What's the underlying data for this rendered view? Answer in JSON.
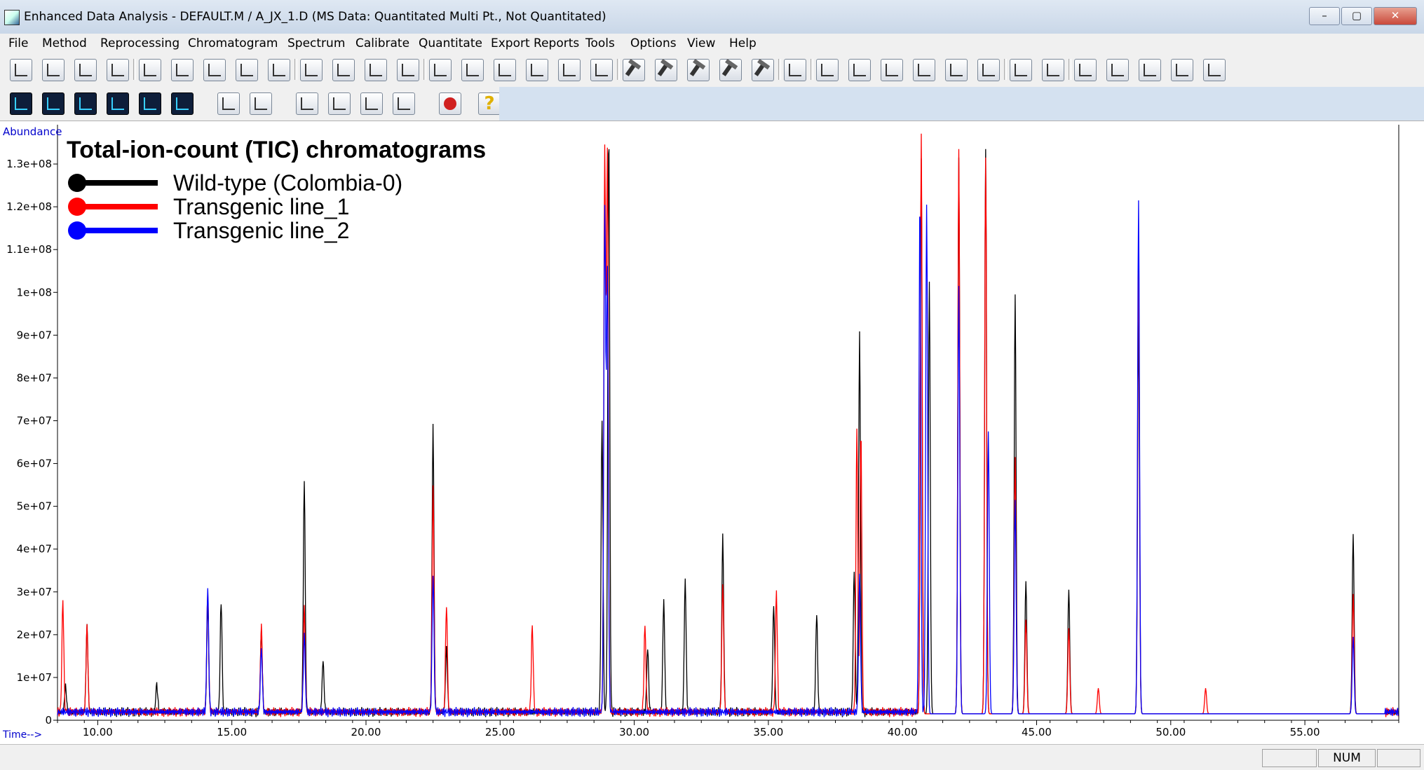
{
  "window": {
    "title": "Enhanced Data Analysis - DEFAULT.M / A_JX_1.D    (MS Data: Quantitated Multi Pt., Not Quantitated)",
    "controls": {
      "minimize": "–",
      "maximize": "▢",
      "close": "✕"
    }
  },
  "menu": [
    "File",
    "Method",
    "Reprocessing",
    "Chromatogram",
    "Spectrum",
    "Calibrate",
    "Quantitate",
    "Export Reports",
    "Tools",
    "Options",
    "View",
    "Help"
  ],
  "toolbar1_icons": [
    "load-data-icon",
    "load-method-icon",
    "print-setup-icon",
    "print-icon",
    "open-file-icon",
    "save-file-icon",
    "run-method-icon",
    "sim-icon",
    "sim-edit-icon",
    "copy-icon",
    "screen-icon",
    "color-grid-icon",
    "windows-icon",
    "report-icon",
    "edit-ions-icon",
    "edit-note-icon",
    "integrate-icon",
    "library-icon",
    "signal-icon",
    "hammer-1-icon",
    "hammer-2-icon",
    "hammer-3-icon",
    "hammer-4-icon",
    "hammer-5-icon",
    "compass-icon",
    "peak-icon",
    "peak-split-icon",
    "calc-icon",
    "bar-icon",
    "building-icon",
    "house-icon",
    "axis-icon",
    "check-axis-icon",
    "chart-up-icon",
    "arrow-up-icon",
    "table-icon",
    "copy-table-icon",
    "edit-table-icon"
  ],
  "toolbar2_icons": [
    "tic-icon",
    "extract-icon",
    "mz-icon",
    "chrom-plus-icon",
    "spectrum-icon",
    "overlay-icon",
    "document-icon",
    "export-icon",
    "checklist-icon",
    "hand-icon",
    "tag-icon",
    "integrator-icon",
    "stop-icon",
    "help-icon"
  ],
  "chart_data": {
    "type": "line",
    "title": "Total-ion-count (TIC) chromatograms",
    "ylabel": "Abundance",
    "xlabel": "Time-->",
    "xlim": [
      8.5,
      58.5
    ],
    "ylim": [
      0,
      140000000
    ],
    "xticks": [
      10,
      15,
      20,
      25,
      30,
      35,
      40,
      45,
      50,
      55
    ],
    "xtick_labels": [
      "10.00",
      "15.00",
      "20.00",
      "25.00",
      "30.00",
      "35.00",
      "40.00",
      "45.00",
      "50.00",
      "55.00"
    ],
    "yticks": [
      0,
      10000000,
      20000000,
      30000000,
      40000000,
      50000000,
      60000000,
      70000000,
      80000000,
      90000000,
      100000000,
      110000000,
      120000000,
      130000000
    ],
    "ytick_labels": [
      "0",
      "1e+07",
      "2e+07",
      "3e+07",
      "4e+07",
      "5e+07",
      "6e+07",
      "7e+07",
      "8e+07",
      "9e+07",
      "1e+08",
      "1.1e+08",
      "1.2e+08",
      "1.3e+08"
    ],
    "legend_position": "top-left",
    "series": [
      {
        "name": "Wild-type (Colombia-0)",
        "color": "#000000",
        "baseline": 1500000,
        "peaks": [
          [
            8.8,
            6000000
          ],
          [
            9.6,
            20000000
          ],
          [
            12.2,
            6500000
          ],
          [
            14.1,
            25000000
          ],
          [
            14.6,
            26000000
          ],
          [
            16.1,
            19000000
          ],
          [
            17.7,
            54000000
          ],
          [
            18.4,
            12000000
          ],
          [
            22.5,
            67000000
          ],
          [
            23.0,
            15000000
          ],
          [
            28.8,
            68000000
          ],
          [
            29.05,
            137000000
          ],
          [
            30.5,
            15000000
          ],
          [
            31.1,
            26000000
          ],
          [
            31.9,
            31000000
          ],
          [
            33.3,
            41000000
          ],
          [
            35.2,
            25000000
          ],
          [
            36.8,
            23000000
          ],
          [
            38.2,
            33000000
          ],
          [
            38.4,
            88000000
          ],
          [
            40.7,
            130000000
          ],
          [
            41.0,
            101000000
          ],
          [
            42.1,
            130000000
          ],
          [
            43.1,
            132000000
          ],
          [
            44.2,
            98000000
          ],
          [
            44.6,
            31000000
          ],
          [
            46.2,
            29000000
          ],
          [
            48.8,
            92000000
          ],
          [
            56.8,
            42000000
          ]
        ]
      },
      {
        "name": "Transgenic line_1",
        "color": "#ff0000",
        "baseline": 1500000,
        "peaks": [
          [
            8.7,
            26000000
          ],
          [
            9.6,
            20000000
          ],
          [
            14.1,
            28000000
          ],
          [
            16.1,
            20000000
          ],
          [
            17.7,
            24000000
          ],
          [
            22.5,
            52000000
          ],
          [
            23.0,
            25000000
          ],
          [
            26.2,
            20000000
          ],
          [
            28.9,
            130000000
          ],
          [
            29.0,
            130000000
          ],
          [
            30.4,
            20000000
          ],
          [
            33.3,
            30000000
          ],
          [
            35.3,
            28000000
          ],
          [
            38.3,
            66000000
          ],
          [
            38.45,
            66000000
          ],
          [
            40.7,
            135000000
          ],
          [
            42.1,
            132000000
          ],
          [
            43.1,
            130000000
          ],
          [
            44.2,
            60000000
          ],
          [
            44.6,
            22000000
          ],
          [
            46.2,
            20000000
          ],
          [
            47.3,
            6000000
          ],
          [
            48.8,
            106000000
          ],
          [
            51.3,
            6000000
          ],
          [
            56.8,
            28000000
          ]
        ]
      },
      {
        "name": "Transgenic line_2",
        "color": "#0000ff",
        "baseline": 1500000,
        "peaks": [
          [
            14.1,
            29000000
          ],
          [
            16.1,
            15000000
          ],
          [
            17.7,
            18000000
          ],
          [
            22.5,
            32000000
          ],
          [
            28.9,
            117000000
          ],
          [
            29.0,
            102000000
          ],
          [
            38.4,
            32000000
          ],
          [
            40.65,
            120000000
          ],
          [
            40.9,
            119000000
          ],
          [
            42.1,
            100000000
          ],
          [
            43.2,
            66000000
          ],
          [
            44.2,
            50000000
          ],
          [
            48.8,
            120000000
          ],
          [
            56.8,
            18000000
          ]
        ]
      }
    ]
  },
  "status": {
    "num": "NUM"
  }
}
